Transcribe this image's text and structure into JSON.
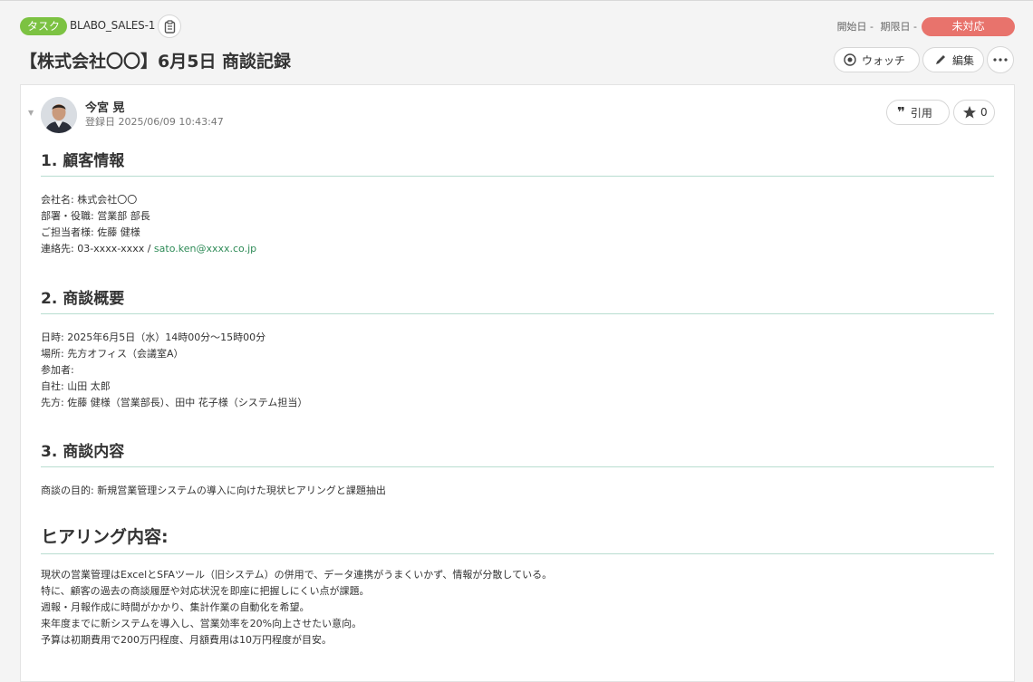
{
  "header": {
    "task_badge": "タスク",
    "task_key": "BLABO_SALES-1",
    "start_date": "開始日 -",
    "due_date": "期限日 -",
    "status": "未対応",
    "title": "【株式会社〇〇】6月5日 商談記録",
    "watch_label": "ウォッチ",
    "edit_label": "編集"
  },
  "comment": {
    "author": "今宮 晃",
    "registered": "登録日  2025/06/09 10:43:47",
    "quote_label": "引用",
    "star_count": "0"
  },
  "sections": {
    "s1_title": "1. 顧客情報",
    "s1_lines": [
      "会社名: 株式会社〇〇",
      "部署・役職: 営業部 部長",
      "ご担当者様: 佐藤 健様"
    ],
    "s1_contact_prefix": "連絡先: 03-xxxx-xxxx / ",
    "s1_email": "sato.ken@xxxx.co.jp",
    "s2_title": "2. 商談概要",
    "s2_lines": [
      "日時: 2025年6月5日（水）14時00分～15時00分",
      "場所: 先方オフィス（会議室A）",
      "参加者:",
      "自社: 山田 太郎",
      "先方: 佐藤 健様（営業部長）、田中 花子様（システム担当）"
    ],
    "s3_title": "3. 商談内容",
    "s3_lines": [
      "商談の目的: 新規営業管理システムの導入に向けた現状ヒアリングと課題抽出"
    ],
    "s4_title": "ヒアリング内容:",
    "s4_lines": [
      "現状の営業管理はExcelとSFAツール（旧システム）の併用で、データ連携がうまくいかず、情報が分散している。",
      "特に、顧客の過去の商談履歴や対応状況を即座に把握しにくい点が課題。",
      "週報・月報作成に時間がかかり、集計作業の自動化を希望。",
      "来年度までに新システムを導入し、営業効率を20%向上させたい意向。",
      "予算は初期費用で200万円程度、月額費用は10万円程度が目安。"
    ]
  },
  "colors": {
    "badge_green": "#7cc242",
    "status_red": "#e8736c",
    "link_green": "#2e8b57",
    "divider": "#b8ddd0"
  }
}
